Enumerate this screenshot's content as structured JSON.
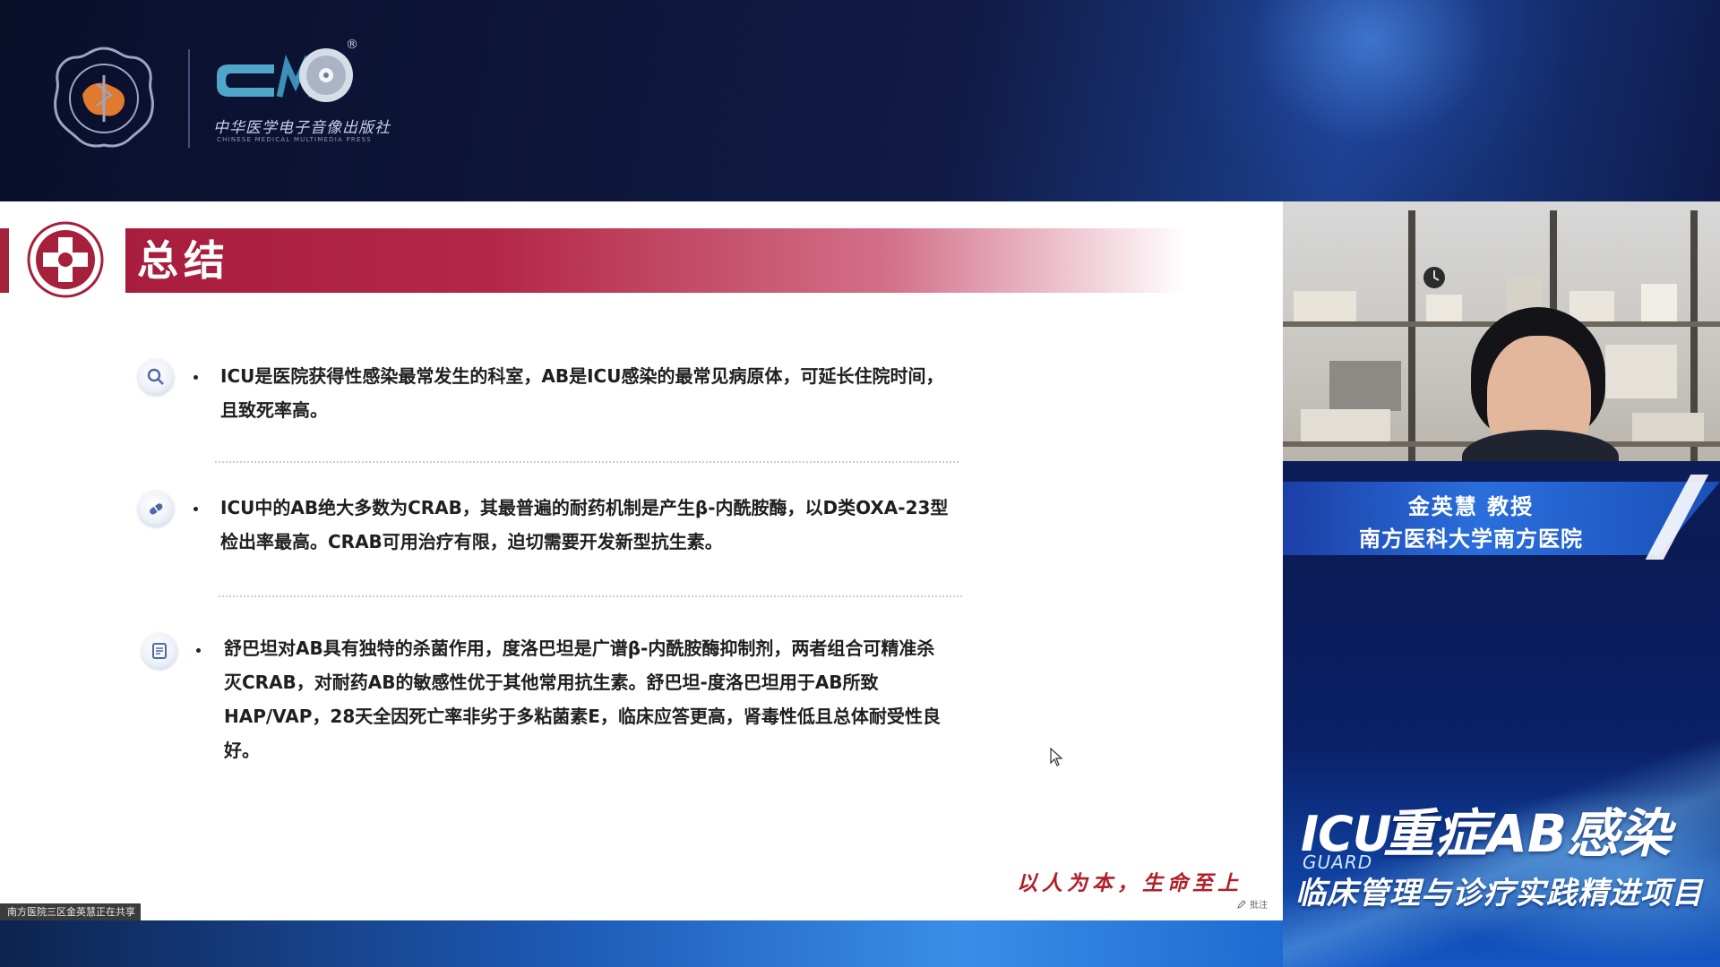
{
  "header": {
    "press_name_cn": "中华医学电子音像出版社",
    "press_name_en": "CHINESE MEDICAL MULTIMEDIA PRESS",
    "press_reg_mark": "®"
  },
  "slide": {
    "title": "总结",
    "items": [
      {
        "icon": "magnifier-icon",
        "text_line1": "ICU是医院获得性感染最常发生的科室，AB是ICU感染的最常见病原体，可延长住院时间，",
        "text_line2": "且致死率高。"
      },
      {
        "icon": "pill-icon",
        "text_line1": "ICU中的AB绝大多数为CRAB，其最普遍的耐药机制是产生β-内酰胺酶，以D类OXA-23型",
        "text_line2": "检出率最高。CRAB可用治疗有限，迫切需要开发新型抗生素。"
      },
      {
        "icon": "document-icon",
        "text_line1": "舒巴坦对AB具有独特的杀菌作用，度洛巴坦是广谱β-内酰胺酶抑制剂，两者组合可精准杀",
        "text_line2": "灭CRAB，对耐药AB的敏感性优于其他常用抗生素。舒巴坦-度洛巴坦用于AB所致",
        "text_line3": "HAP/VAP，28天全因死亡率非劣于多粘菌素E，临床应答更高，肾毒性低且总体耐受性良",
        "text_line4": "好。"
      }
    ],
    "bullet": "•",
    "slogan": "以人为本，生命至上",
    "note_label": "批注"
  },
  "share_status": "南方医院三区金英慧正在共享",
  "speaker": {
    "name": "金英慧 教授",
    "organization": "南方医科大学南方医院"
  },
  "brand": {
    "icu": "ICU",
    "guard": "GUARD",
    "main": "重症AB感染",
    "subtitle": "临床管理与诊疗实践精进项目"
  },
  "colors": {
    "title_bar": "#a81d3e",
    "slogan": "#b01f2a",
    "name_banner": "#2a6fdc"
  }
}
